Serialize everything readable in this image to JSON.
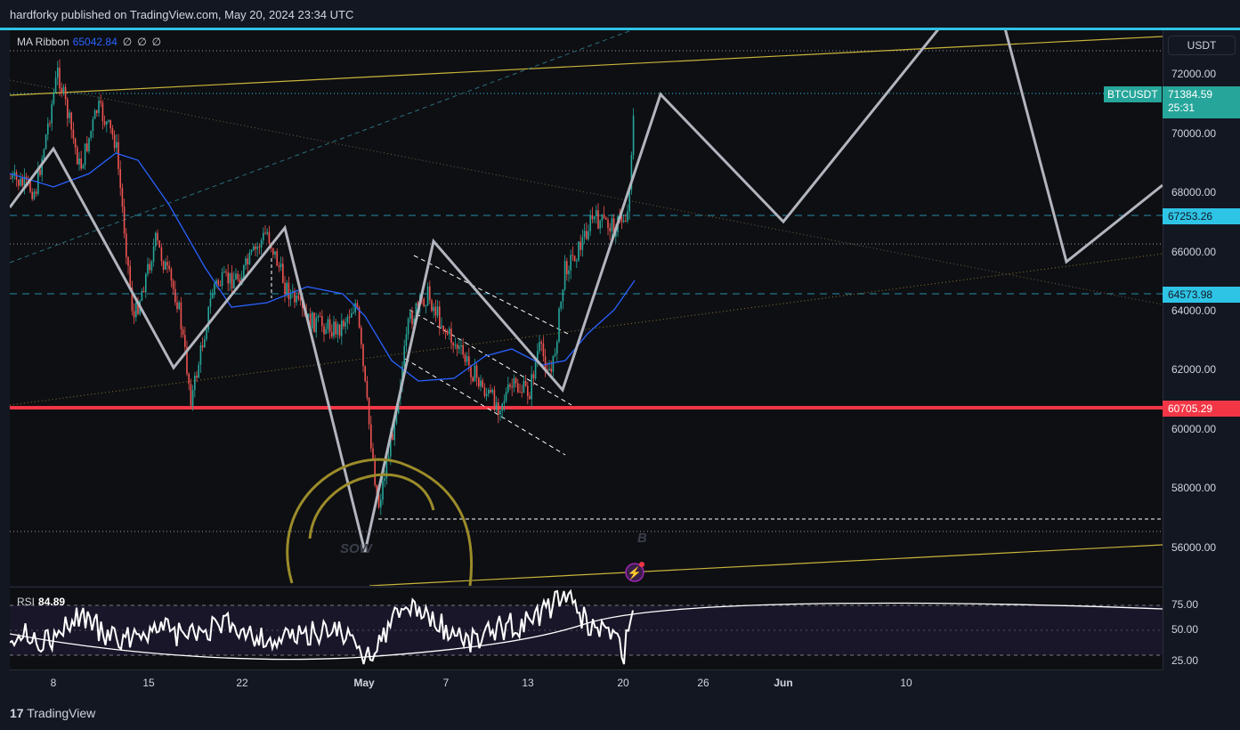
{
  "header": {
    "published": "hardforky published on TradingView.com, May 20, 2024 23:34 UTC"
  },
  "indicator": {
    "name": "MA Ribbon",
    "value": "65042.84",
    "extras": [
      "∅",
      "∅",
      "∅"
    ]
  },
  "rsi": {
    "name": "RSI",
    "value": "84.89",
    "levels": [
      "75.00",
      "50.00",
      "25.00"
    ]
  },
  "currency_button": "USDT",
  "symbol_tag": "BTCUSDT",
  "last_price": {
    "value": "71384.59",
    "countdown": "25:31"
  },
  "price_ticks": [
    "72000.00",
    "70000.00",
    "68000.00",
    "66000.00",
    "64000.00",
    "62000.00",
    "60000.00",
    "58000.00",
    "56000.00"
  ],
  "price_levels": [
    {
      "label": "67253.26",
      "color": "#2ec4e6"
    },
    {
      "label": "64573.98",
      "color": "#2ec4e6"
    },
    {
      "label": "60705.29",
      "color": "#f23645"
    }
  ],
  "time_ticks": [
    {
      "label": "8",
      "bold": false
    },
    {
      "label": "15",
      "bold": false
    },
    {
      "label": "22",
      "bold": false
    },
    {
      "label": "May",
      "bold": true
    },
    {
      "label": "7",
      "bold": false
    },
    {
      "label": "13",
      "bold": false
    },
    {
      "label": "20",
      "bold": false
    },
    {
      "label": "26",
      "bold": false
    },
    {
      "label": "Jun",
      "bold": true
    },
    {
      "label": "10",
      "bold": false
    }
  ],
  "annotations": {
    "sow": "SOW",
    "b": "B"
  },
  "footer": {
    "brand": "TradingView"
  },
  "colors": {
    "background": "#131722",
    "pane": "#0e0f13",
    "up": "#26a69a",
    "down": "#ef5350",
    "ma": "#2962ff",
    "accent": "#2ec4e6",
    "support": "#f23645"
  }
}
